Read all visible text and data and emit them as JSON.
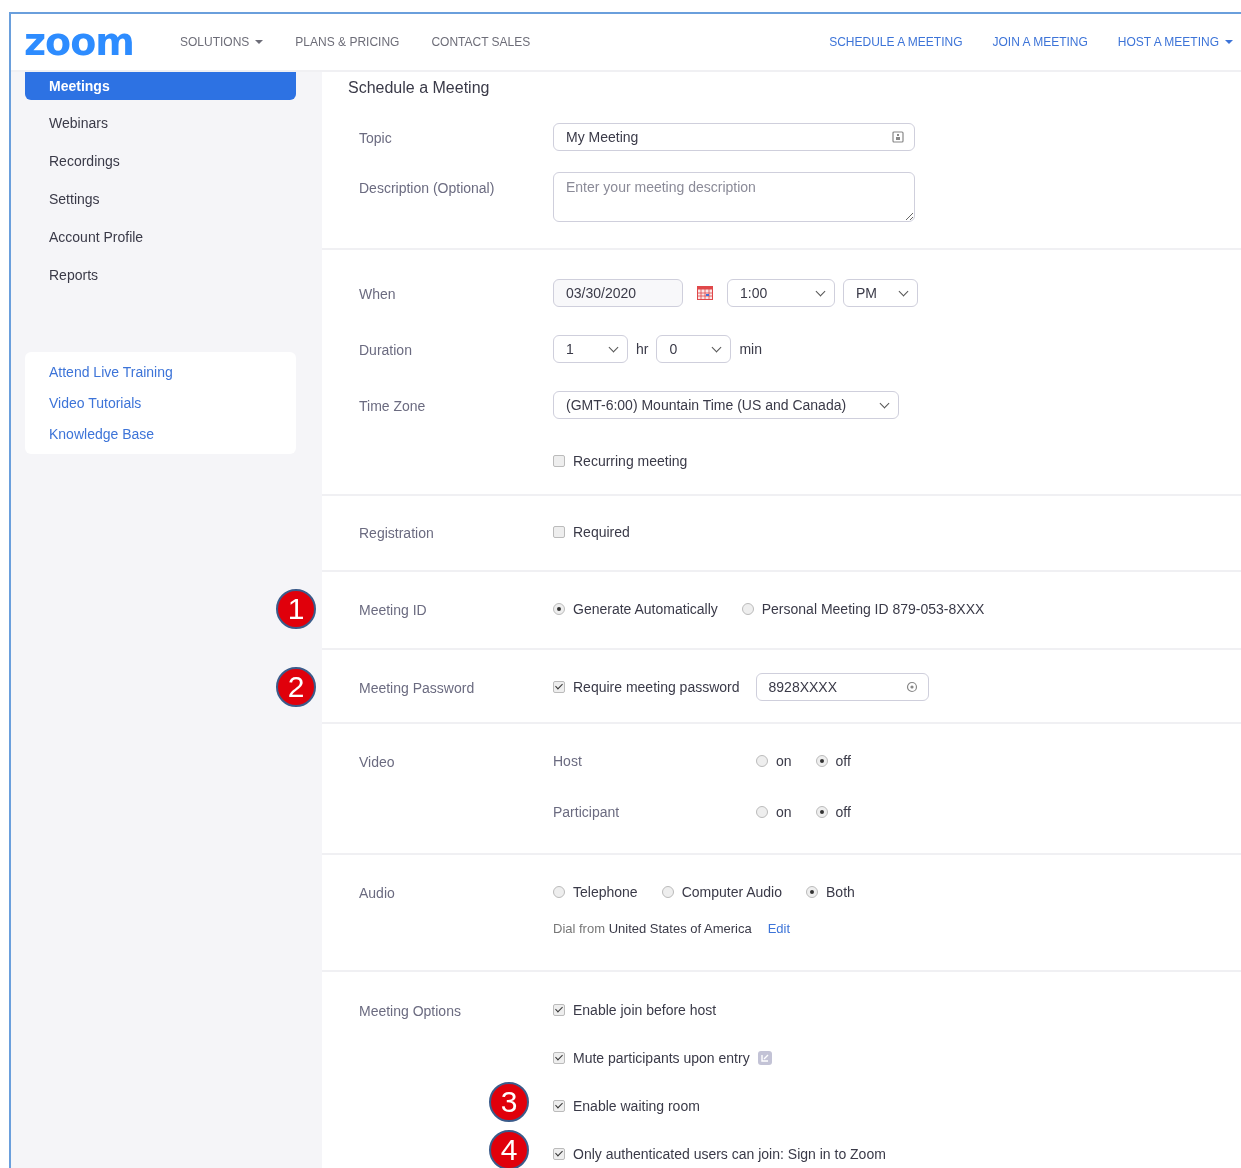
{
  "header": {
    "logo": "zoom",
    "nav": [
      {
        "label": "SOLUTIONS",
        "dropdown": true
      },
      {
        "label": "PLANS & PRICING",
        "dropdown": false
      },
      {
        "label": "CONTACT SALES",
        "dropdown": false
      }
    ],
    "actions": [
      {
        "label": "SCHEDULE A MEETING",
        "dropdown": false
      },
      {
        "label": "JOIN A MEETING",
        "dropdown": false
      },
      {
        "label": "HOST A MEETING",
        "dropdown": true
      }
    ]
  },
  "sidebar": {
    "items": [
      {
        "label": "Meetings",
        "selected": true
      },
      {
        "label": "Webinars",
        "selected": false
      },
      {
        "label": "Recordings",
        "selected": false
      },
      {
        "label": "Settings",
        "selected": false
      },
      {
        "label": "Account Profile",
        "selected": false
      },
      {
        "label": "Reports",
        "selected": false
      }
    ],
    "links": [
      "Attend Live Training",
      "Video Tutorials",
      "Knowledge Base"
    ]
  },
  "page_title": "Schedule a Meeting",
  "sections": [
    {
      "rows": [
        {
          "label": "Topic",
          "kind": "text",
          "value": "My Meeting"
        },
        {
          "label": "Description (Optional)",
          "kind": "textarea",
          "placeholder": "Enter your meeting description"
        }
      ]
    },
    {
      "rows": [
        {
          "label": "When",
          "kind": "datetime",
          "date": "03/30/2020",
          "time": "1:00",
          "ampm": "PM"
        },
        {
          "label": "Duration",
          "kind": "duration",
          "hours": "1",
          "hours_unit": "hr",
          "minutes": "0",
          "minutes_unit": "min"
        },
        {
          "label": "Time Zone",
          "kind": "select",
          "value": "(GMT-6:00) Mountain Time (US and Canada)"
        },
        {
          "kind": "checkbox",
          "text": "Recurring meeting",
          "checked": false
        }
      ]
    },
    {
      "rows": [
        {
          "label": "Registration",
          "kind": "checkbox",
          "text": "Required",
          "checked": false
        }
      ]
    },
    {
      "rows": [
        {
          "label": "Meeting ID",
          "marker": "1",
          "kind": "radios",
          "options": [
            {
              "label": "Generate Automatically",
              "selected": true
            },
            {
              "label": "Personal Meeting ID 879-053-8XXX",
              "selected": false
            }
          ]
        }
      ]
    },
    {
      "rows": [
        {
          "label": "Meeting Password",
          "marker": "2",
          "kind": "checkbox_field",
          "text": "Require meeting password",
          "checked": true,
          "value": "8928XXXX"
        }
      ]
    },
    {
      "rows": [
        {
          "label": "Video",
          "sublabel": "Host",
          "kind": "radios",
          "options": [
            {
              "label": "on",
              "selected": false
            },
            {
              "label": "off",
              "selected": true
            }
          ]
        },
        {
          "sublabel": "Participant",
          "kind": "radios",
          "options": [
            {
              "label": "on",
              "selected": false
            },
            {
              "label": "off",
              "selected": true
            }
          ]
        }
      ]
    },
    {
      "rows": [
        {
          "label": "Audio",
          "kind": "radios",
          "options": [
            {
              "label": "Telephone",
              "selected": false
            },
            {
              "label": "Computer Audio",
              "selected": false
            },
            {
              "label": "Both",
              "selected": true
            }
          ]
        },
        {
          "kind": "note",
          "prefix": "Dial from",
          "text": "United States of America",
          "link": "Edit"
        }
      ]
    },
    {
      "rows": [
        {
          "label": "Meeting Options",
          "kind": "checkbox",
          "text": "Enable join before host",
          "checked": true
        },
        {
          "kind": "checkbox",
          "text": "Mute participants upon entry",
          "checked": true,
          "info_icon": true
        },
        {
          "marker": "3",
          "kind": "checkbox",
          "text": "Enable waiting room",
          "checked": true
        },
        {
          "marker": "4",
          "kind": "checkbox",
          "text": "Only authenticated users can join: Sign in to Zoom",
          "checked": true
        }
      ]
    }
  ]
}
